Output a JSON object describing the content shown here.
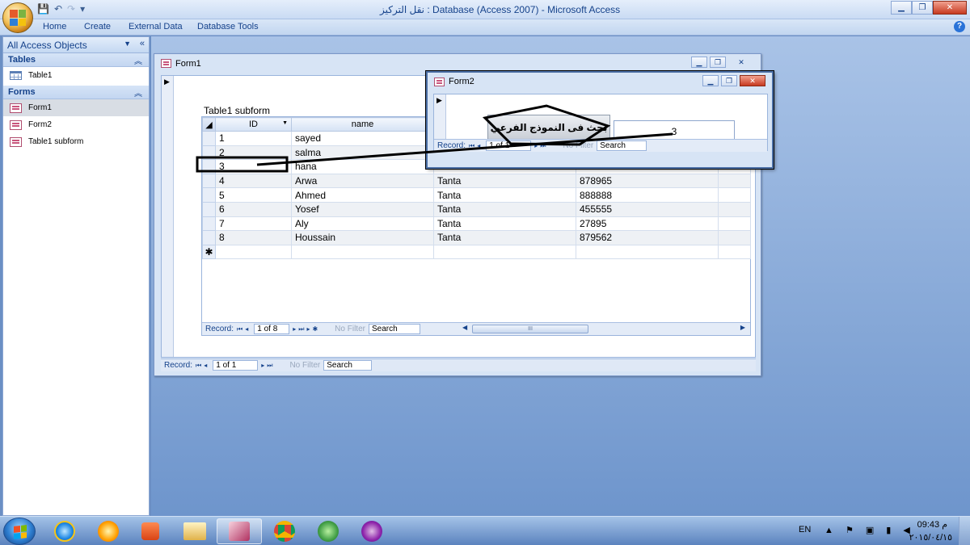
{
  "app": {
    "title": "نقل التركيز : Database (Access 2007) - Microsoft Access",
    "window_controls": [
      "minimize",
      "restore",
      "close"
    ]
  },
  "ribbon": {
    "tabs": [
      "Home",
      "Create",
      "External Data",
      "Database Tools"
    ]
  },
  "nav_pane": {
    "header": "All Access Objects",
    "groups": [
      {
        "label": "Tables",
        "items": [
          "Table1"
        ]
      },
      {
        "label": "Forms",
        "items": [
          "Form1",
          "Form2",
          "Table1 subform"
        ]
      }
    ],
    "selected": "Form1"
  },
  "form1": {
    "title": "Form1",
    "subform_label": "Table1 subform",
    "columns": [
      "ID",
      "name",
      "",
      "",
      ""
    ],
    "rows": [
      [
        "1",
        "sayed",
        "",
        ""
      ],
      [
        "2",
        "salma",
        "",
        ""
      ],
      [
        "3",
        "hana",
        "",
        ""
      ],
      [
        "4",
        "Arwa",
        "Tanta",
        "878965"
      ],
      [
        "5",
        "Ahmed",
        "Tanta",
        "888888"
      ],
      [
        "6",
        "Yosef",
        "Tanta",
        "455555"
      ],
      [
        "7",
        "Aly",
        "Tanta",
        "27895"
      ],
      [
        "8",
        "Houssain",
        "Tanta",
        "879562"
      ]
    ],
    "new_row_marker": "✱",
    "sub_nav": {
      "label": "Record:",
      "position": "1 of 8",
      "filter": "No Filter",
      "search": "Search",
      "scroll_thumb": "III"
    },
    "main_nav": {
      "label": "Record:",
      "position": "1 of 1",
      "filter": "No Filter",
      "search": "Search"
    }
  },
  "form2": {
    "title": "Form2",
    "button_label": "بحث فى النموذج الفرعي",
    "field_value": "3",
    "nav": {
      "label": "Record:",
      "position": "1 of 1",
      "filter": "No Filter",
      "search": "Search"
    }
  },
  "taskbar": {
    "lang": "EN",
    "time": "09:43 م",
    "date": "٢٠١٥/٠٤/١٥",
    "tray_icons": "▲ ⚑ ▣ ▮ ◀"
  },
  "colors": {
    "access_blue": "#15428b",
    "workspace": "#6e95cc",
    "annotation": "#000000"
  }
}
